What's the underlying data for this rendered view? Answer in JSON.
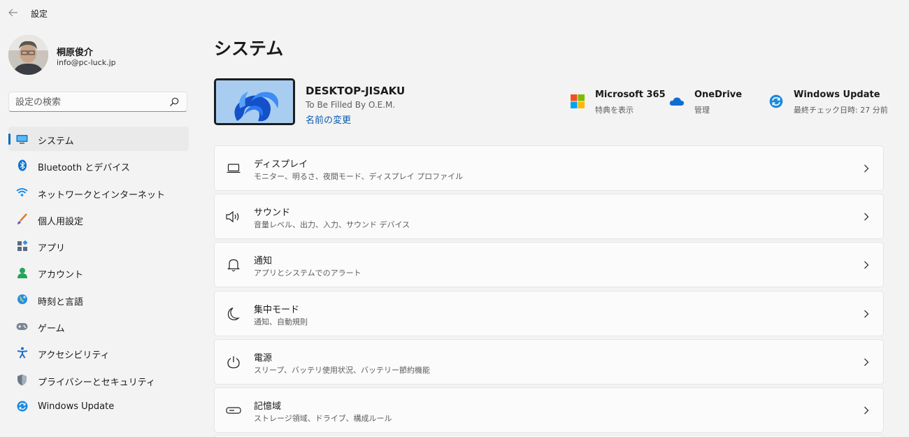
{
  "titlebar": {
    "title": "設定"
  },
  "profile": {
    "name": "桐原俊介",
    "email": "info@pc-luck.jp"
  },
  "search": {
    "placeholder": "設定の検索"
  },
  "sidebar": {
    "items": [
      {
        "label": "システム",
        "icon": "system-icon",
        "active": true
      },
      {
        "label": "Bluetooth とデバイス",
        "icon": "bluetooth-icon"
      },
      {
        "label": "ネットワークとインターネット",
        "icon": "wifi-icon"
      },
      {
        "label": "個人用設定",
        "icon": "brush-icon"
      },
      {
        "label": "アプリ",
        "icon": "apps-icon"
      },
      {
        "label": "アカウント",
        "icon": "account-icon"
      },
      {
        "label": "時刻と言語",
        "icon": "time-language-icon"
      },
      {
        "label": "ゲーム",
        "icon": "gamepad-icon"
      },
      {
        "label": "アクセシビリティ",
        "icon": "accessibility-icon"
      },
      {
        "label": "プライバシーとセキュリティ",
        "icon": "shield-icon"
      },
      {
        "label": "Windows Update",
        "icon": "windows-update-icon"
      }
    ]
  },
  "main": {
    "title": "システム",
    "device": {
      "name": "DESKTOP-JISAKU",
      "model": "To Be Filled By O.E.M.",
      "rename": "名前の変更"
    },
    "quick": [
      {
        "title": "Microsoft 365",
        "sub": "特典を表示",
        "icon": "microsoft-365-icon"
      },
      {
        "title": "OneDrive",
        "sub": "管理",
        "icon": "onedrive-icon"
      },
      {
        "title": "Windows Update",
        "sub": "最終チェック日時: 27 分前",
        "icon": "windows-update-icon"
      }
    ],
    "cards": [
      {
        "title": "ディスプレイ",
        "sub": "モニター、明るさ、夜間モード、ディスプレイ プロファイル",
        "icon": "display-icon"
      },
      {
        "title": "サウンド",
        "sub": "音量レベル、出力、入力、サウンド デバイス",
        "icon": "speaker-icon"
      },
      {
        "title": "通知",
        "sub": "アプリとシステムでのアラート",
        "icon": "bell-icon"
      },
      {
        "title": "集中モード",
        "sub": "通知、自動規則",
        "icon": "moon-icon"
      },
      {
        "title": "電源",
        "sub": "スリープ、バッテリ使用状況、バッテリー節約機能",
        "icon": "power-icon"
      },
      {
        "title": "記憶域",
        "sub": "ストレージ領域、ドライブ、構成ルール",
        "icon": "storage-icon"
      }
    ]
  },
  "colors": {
    "accent": "#0067c0",
    "background": "#f3f3f3",
    "card": "#fbfbfb"
  }
}
